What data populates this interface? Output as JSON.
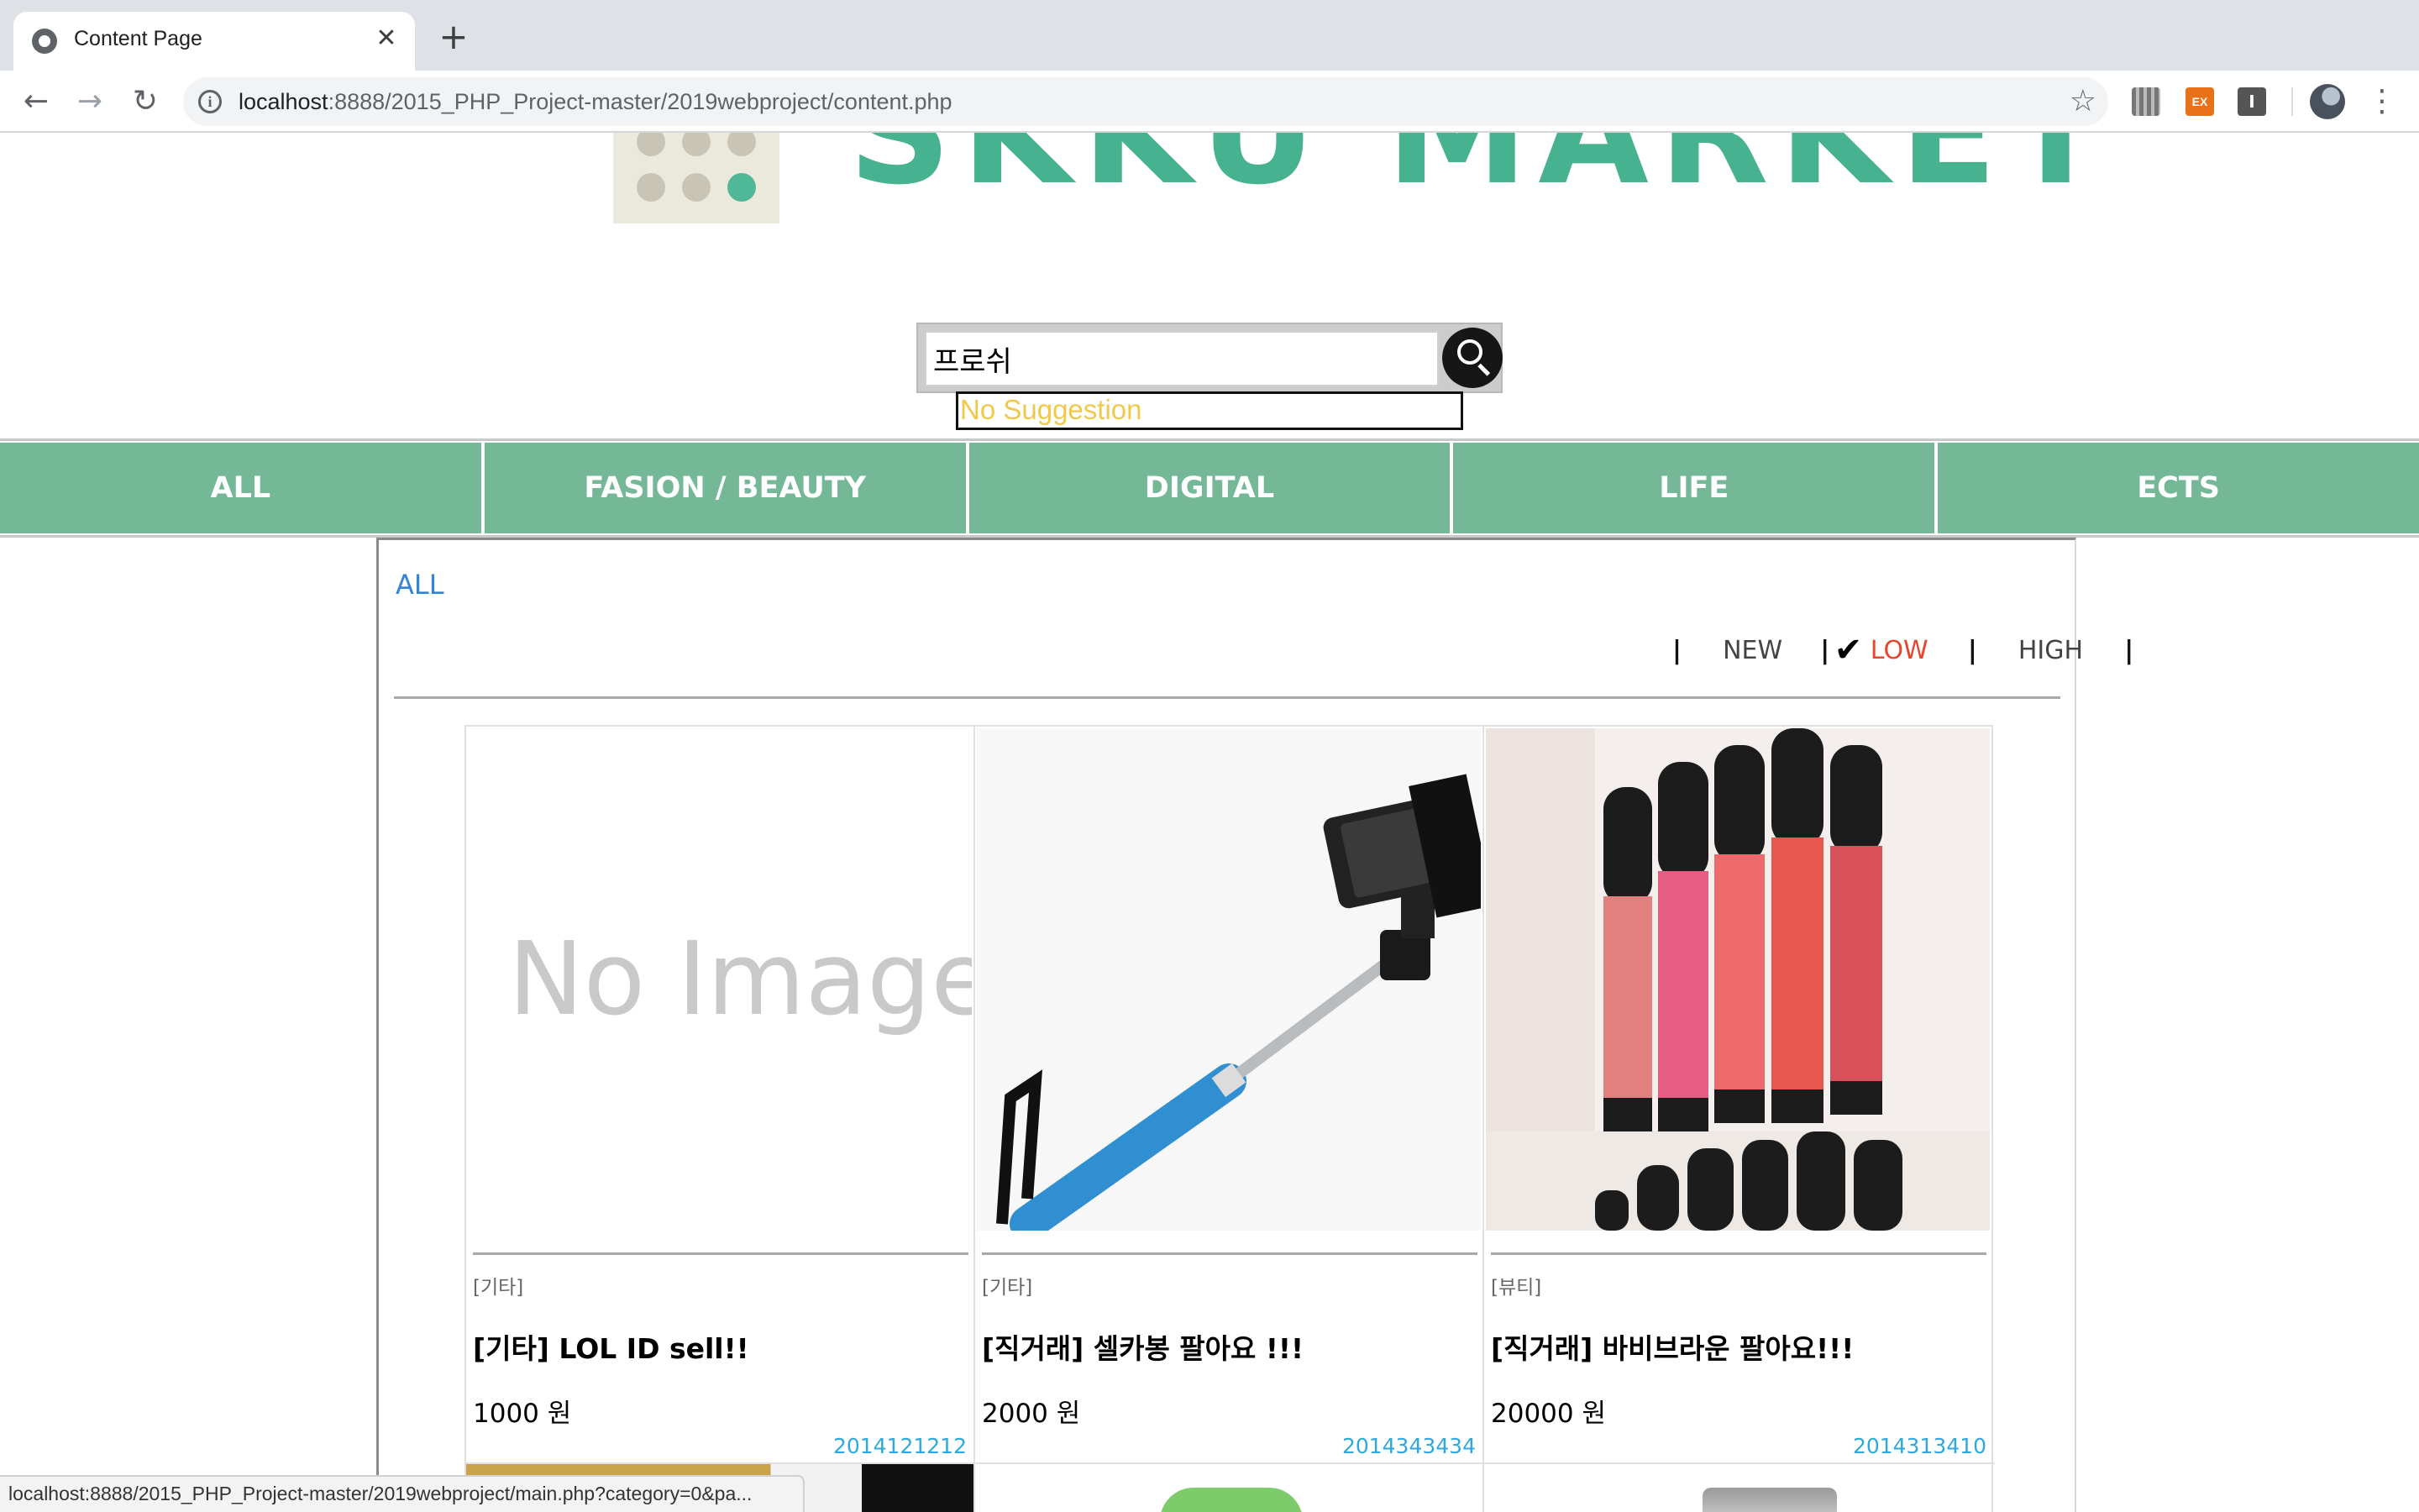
{
  "browser": {
    "tab_title": "Content Page",
    "url_host": "localhost",
    "url_rest": ":8888/2015_PHP_Project-master/2019webproject/content.php",
    "extension_ex_label": "EX",
    "extension_i_label": "I"
  },
  "site": {
    "logo_text": "SKKU MARKET"
  },
  "search": {
    "value": "프로쉬",
    "suggestion": "No Suggestion"
  },
  "menu": {
    "items": [
      {
        "label": "ALL"
      },
      {
        "label": "FASION / BEAUTY"
      },
      {
        "label": "DIGITAL"
      },
      {
        "label": "LIFE"
      },
      {
        "label": "ECTS"
      }
    ]
  },
  "content": {
    "category": "ALL",
    "sort": {
      "new": "NEW",
      "low": "LOW",
      "high": "HIGH",
      "active": "LOW"
    },
    "products": [
      {
        "image": "No Image",
        "category": "[기타]",
        "title": "[기타] LOL ID sell!!",
        "price": "1000 원",
        "seller": "2014121212"
      },
      {
        "image": "selfie-stick",
        "category": "[기타]",
        "title": "[직거래] 셀카봉 팔아요 !!!",
        "price": "2000 원",
        "seller": "2014343434"
      },
      {
        "image": "lip-gloss",
        "category": "[뷰티]",
        "title": "[직거래] 바비브라운 팔아요!!!",
        "price": "20000 원",
        "seller": "2014313410"
      }
    ]
  },
  "status_bar": {
    "text": "localhost:8888/2015_PHP_Project-master/2019webproject/main.php?category=0&pa..."
  },
  "colors": {
    "menu_green": "#75b898",
    "logo_green": "#47b28f",
    "active_sort": "#e8452f",
    "seller_blue": "#2fa8df",
    "link_blue": "#3383d8"
  }
}
